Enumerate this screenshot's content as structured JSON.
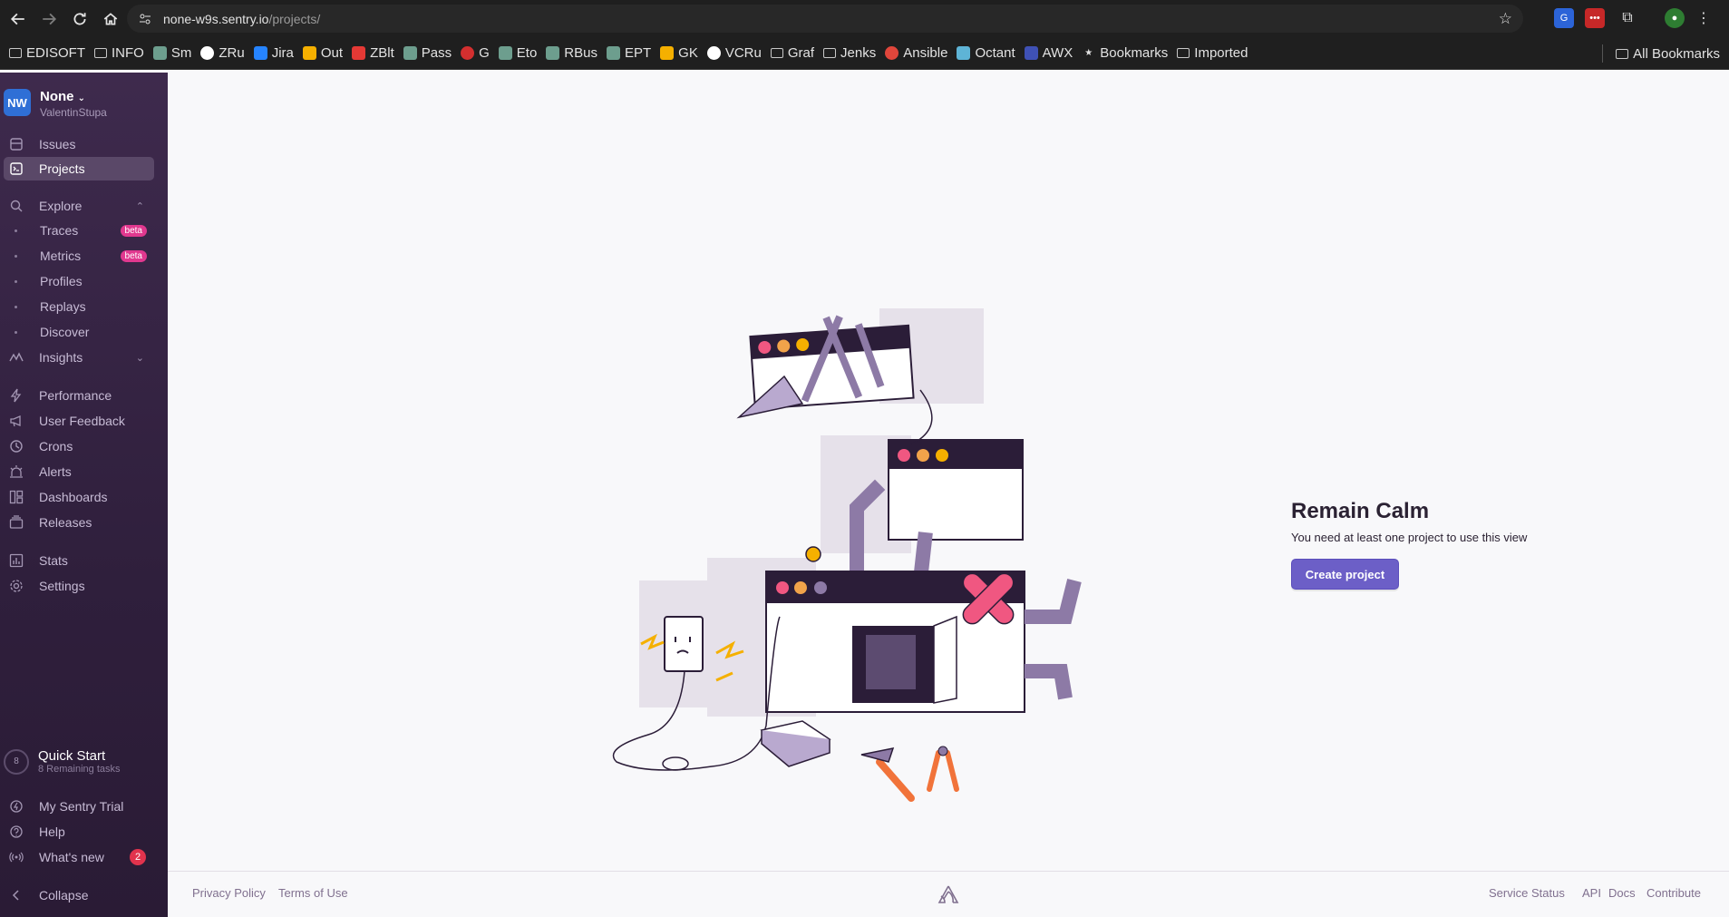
{
  "browser": {
    "url_site": "none-w9s.sentry.io",
    "url_path": "/projects/",
    "bookmarks": [
      {
        "label": "EDISOFT",
        "icon": "folder-icon"
      },
      {
        "label": "INFO",
        "icon": "folder-icon"
      },
      {
        "label": "Sm",
        "icon": "sm-icon"
      },
      {
        "label": "ZRu",
        "icon": "globe-icon"
      },
      {
        "label": "Jira",
        "icon": "jira-icon"
      },
      {
        "label": "Out",
        "icon": "mail-icon"
      },
      {
        "label": "ZBlt",
        "icon": "z-icon"
      },
      {
        "label": "Pass",
        "icon": "pass-icon"
      },
      {
        "label": "G",
        "icon": "g-icon"
      },
      {
        "label": "Eto",
        "icon": "eto-icon"
      },
      {
        "label": "RBus",
        "icon": "rbus-icon"
      },
      {
        "label": "EPT",
        "icon": "ept-icon"
      },
      {
        "label": "GK",
        "icon": "gk-icon"
      },
      {
        "label": "VCRu",
        "icon": "globe-icon"
      },
      {
        "label": "Graf",
        "icon": "folder-icon"
      },
      {
        "label": "Jenks",
        "icon": "folder-icon"
      },
      {
        "label": "Ansible",
        "icon": "ansible-icon"
      },
      {
        "label": "Octant",
        "icon": "octant-icon"
      },
      {
        "label": "AWX",
        "icon": "awx-icon"
      },
      {
        "label": "Bookmarks",
        "icon": "star-icon"
      },
      {
        "label": "Imported",
        "icon": "folder-icon"
      }
    ],
    "all_bookmarks": "All Bookmarks"
  },
  "sidebar": {
    "org_initials": "NW",
    "org_name": "None",
    "org_user": "ValentinStupa",
    "items": {
      "issues": "Issues",
      "projects": "Projects",
      "explore": "Explore",
      "traces": "Traces",
      "metrics": "Metrics",
      "profiles": "Profiles",
      "replays": "Replays",
      "discover": "Discover",
      "insights": "Insights",
      "performance": "Performance",
      "user_feedback": "User Feedback",
      "crons": "Crons",
      "alerts": "Alerts",
      "dashboards": "Dashboards",
      "releases": "Releases",
      "stats": "Stats",
      "settings": "Settings"
    },
    "beta_label": "beta",
    "quick_start": {
      "count": "8",
      "title": "Quick Start",
      "subtitle": "8 Remaining tasks"
    },
    "trial": "My Sentry Trial",
    "help": "Help",
    "whats_new": "What's new",
    "whats_new_count": "2",
    "collapse": "Collapse"
  },
  "main": {
    "title": "Remain Calm",
    "description": "You need at least one project to use this view",
    "create_button": "Create project"
  },
  "footer": {
    "privacy": "Privacy Policy",
    "terms": "Terms of Use",
    "status": "Service Status",
    "api": "API",
    "docs": "Docs",
    "contribute": "Contribute"
  },
  "colors": {
    "accent": "#6c5fc7",
    "sidebar_bg": "#3e2a4d",
    "beta_badge": "#e1388f"
  }
}
